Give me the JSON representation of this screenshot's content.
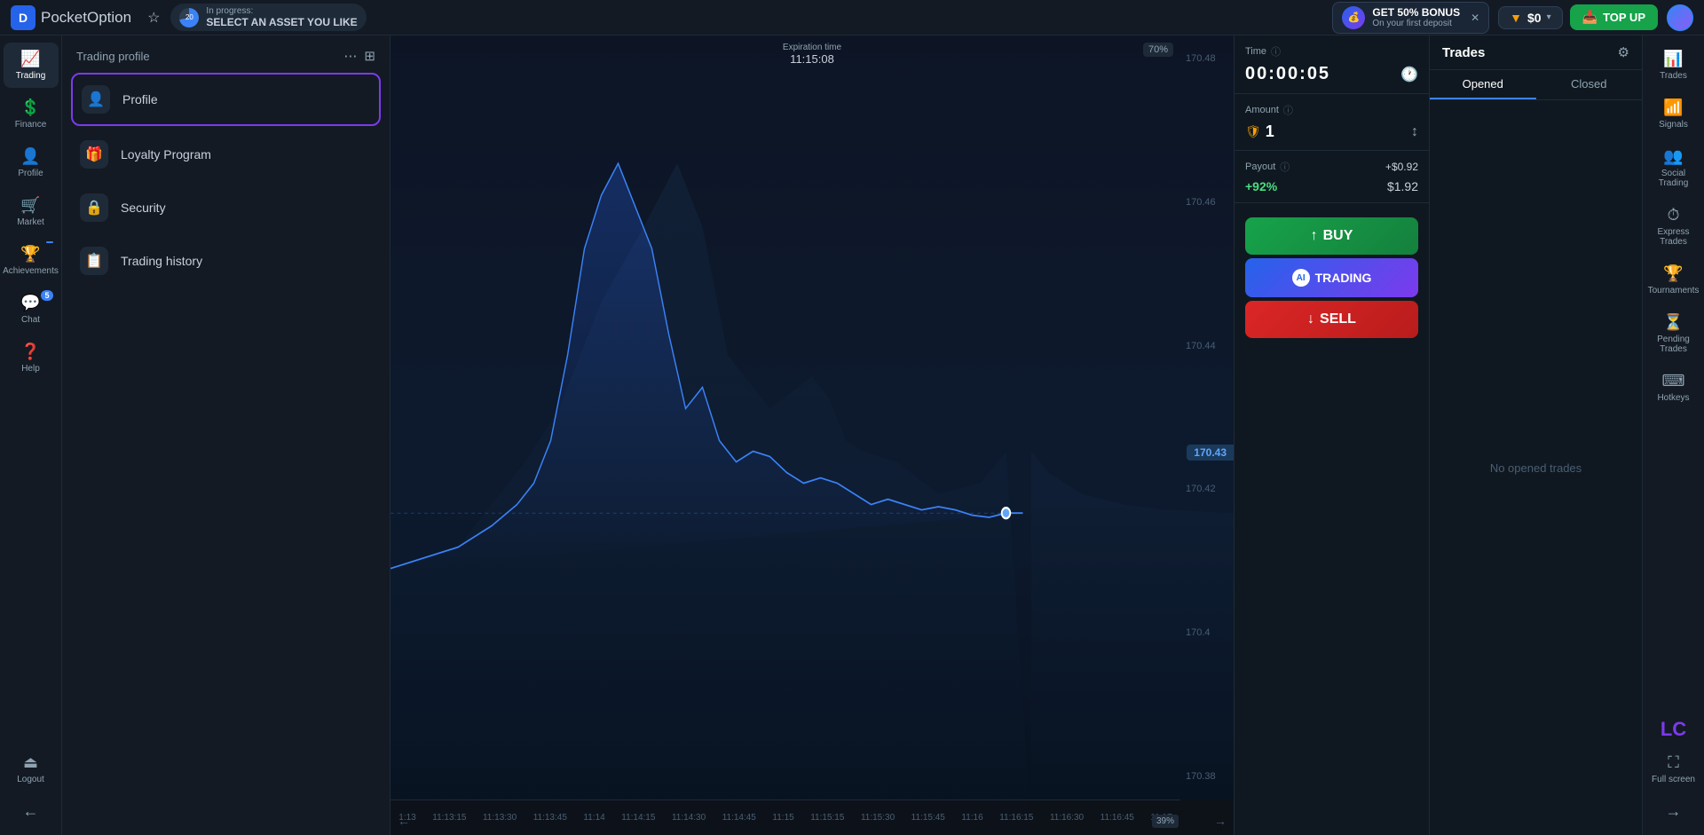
{
  "topbar": {
    "logo_text_bold": "Pocket",
    "logo_text_light": "Option",
    "progress_label": "In progress:",
    "progress_value": "SELECT AN ASSET YOU LIKE",
    "bonus_title": "GET 50% BONUS",
    "bonus_sub": "On your first deposit",
    "balance": "$0",
    "topup_label": "TOP UP"
  },
  "left_sidebar": {
    "items": [
      {
        "id": "trading",
        "label": "Trading",
        "icon": "📈"
      },
      {
        "id": "finance",
        "label": "Finance",
        "icon": "💲"
      },
      {
        "id": "profile",
        "label": "Profile",
        "icon": "👤"
      },
      {
        "id": "market",
        "label": "Market",
        "icon": "🛒"
      },
      {
        "id": "achievements",
        "label": "Achievements",
        "icon": "🏆",
        "badge": ""
      },
      {
        "id": "chat",
        "label": "Chat",
        "icon": "💬",
        "badge": "5"
      },
      {
        "id": "help",
        "label": "Help",
        "icon": "❓"
      },
      {
        "id": "logout",
        "label": "Logout",
        "icon": "⏏"
      }
    ]
  },
  "profile_menu": {
    "header": "Trading profile",
    "items": [
      {
        "id": "profile",
        "label": "Profile",
        "icon": "👤",
        "selected": true
      },
      {
        "id": "loyalty",
        "label": "Loyalty Program",
        "icon": "🎁",
        "selected": false
      },
      {
        "id": "security",
        "label": "Security",
        "icon": "🔒",
        "selected": false
      },
      {
        "id": "history",
        "label": "Trading history",
        "icon": "📋",
        "selected": false
      }
    ]
  },
  "chart": {
    "expiry_label": "Expiration time",
    "expiry_time": "11:15:08",
    "current_price": "170.43",
    "price_70_pct": "70%",
    "prices": [
      "170.48",
      "170.46",
      "170.44",
      "170.42",
      "170.4",
      "170.38"
    ],
    "times": [
      "1:13",
      "11:13:15",
      "11:13:30",
      "11:13:45",
      "11:14",
      "11:14:15",
      "11:14:30",
      "11:14:45",
      "11:15",
      "11:15:15",
      "11:15:30",
      "11:15:45",
      "11:16",
      "11:16:15",
      "11:16:30",
      "11:16:45",
      "11:17"
    ],
    "bottom_pct": "39%"
  },
  "trading_panel": {
    "time_label": "Time",
    "timer": "00:00:05",
    "amount_label": "Amount",
    "amount": "1",
    "payout_label": "Payout",
    "payout_pct": "+$0.92",
    "payout_display": "+92%",
    "payout_amount": "$1.92",
    "buy_label": "BUY",
    "sell_label": "SELL",
    "ai_label": "TRADING"
  },
  "trades_panel": {
    "title": "Trades",
    "tab_opened": "Opened",
    "tab_closed": "Closed",
    "empty_message": "No opened trades"
  },
  "right_sidebar": {
    "items": [
      {
        "id": "trades",
        "label": "Trades",
        "icon": "📊"
      },
      {
        "id": "signals",
        "label": "Signals",
        "icon": "📶"
      },
      {
        "id": "social-trading",
        "label": "Social Trading",
        "icon": "👥"
      },
      {
        "id": "express-trades",
        "label": "Express Trades",
        "icon": "⏱"
      },
      {
        "id": "tournaments",
        "label": "Tournaments",
        "icon": "🏆"
      },
      {
        "id": "pending-trades",
        "label": "Pending Trades",
        "icon": "⏳"
      },
      {
        "id": "hotkeys",
        "label": "Hotkeys",
        "icon": "⌨"
      },
      {
        "id": "fullscreen",
        "label": "Full screen",
        "icon": "⛶"
      }
    ]
  }
}
